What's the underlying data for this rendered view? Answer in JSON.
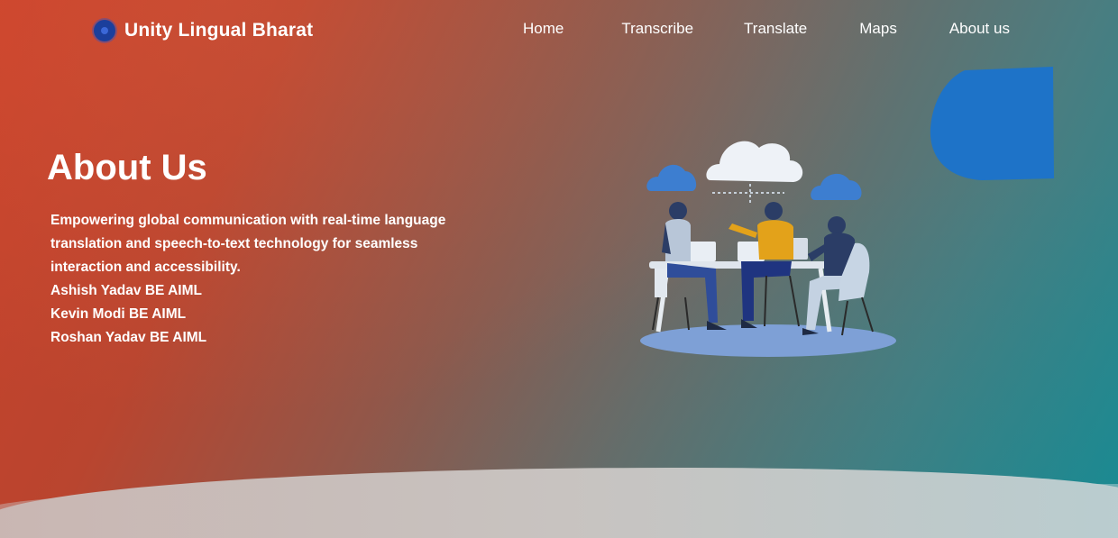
{
  "brand": {
    "name": "Unity Lingual Bharat"
  },
  "nav": {
    "items": [
      {
        "label": "Home"
      },
      {
        "label": "Transcribe"
      },
      {
        "label": "Translate"
      },
      {
        "label": "Maps"
      },
      {
        "label": "About us"
      }
    ]
  },
  "hero": {
    "title": "About Us",
    "description": "Empowering global communication with real-time language translation and speech-to-text technology for seamless interaction and accessibility.",
    "members": [
      "Ashish Yadav BE AIML",
      "Kevin Modi BE AIML",
      "Roshan Yadav BE AIML"
    ]
  },
  "icons": {
    "logo": "logo-dot-icon",
    "illustration": "team-cloud-illustration",
    "decoration": "blue-blob-shape"
  },
  "colors": {
    "background_start": "#c8412a",
    "background_end": "#1f8a92",
    "accent_blue": "#1e73c8",
    "text": "#ffffff"
  }
}
